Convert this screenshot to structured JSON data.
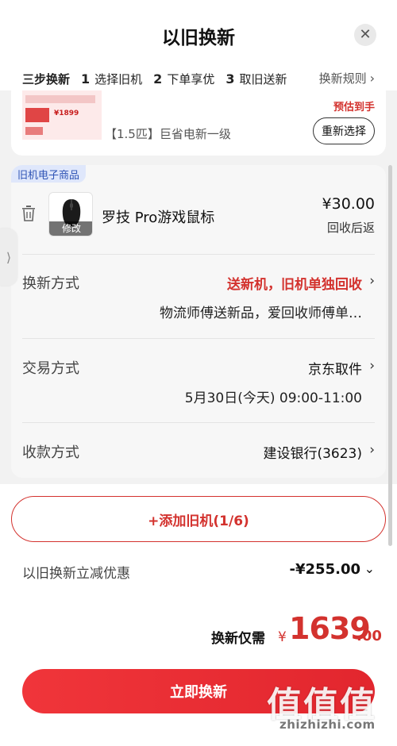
{
  "header": {
    "title": "以旧换新",
    "close_icon": "close-icon"
  },
  "steps": {
    "title": "三步换新",
    "items": [
      {
        "num": "1",
        "label": "选择旧机"
      },
      {
        "num": "2",
        "label": "下单享优"
      },
      {
        "num": "3",
        "label": "取旧送新"
      }
    ],
    "rules_label": "换新规则",
    "rules_icon": "chevron-right-icon"
  },
  "new_product": {
    "estimate_label": "预估到手",
    "name": "【1.5匹】巨省电新一级",
    "reselect_label": "重新选择",
    "thumb_price": "¥1899"
  },
  "old_item": {
    "tag": "旧机电子商品",
    "name": "罗技 Pro游戏鼠标",
    "edit_label": "修改",
    "price": "¥30.00",
    "price_note": "回收后返"
  },
  "rows": {
    "exchange": {
      "label": "换新方式",
      "value": "送新机，旧机单独回收",
      "sub": "物流师傅送新品，爱回收师傅单…"
    },
    "transaction": {
      "label": "交易方式",
      "value": "京东取件",
      "sub": "5月30日(今天) 09:00-11:00"
    },
    "payment": {
      "label": "收款方式",
      "value": "建设银行(3623)"
    }
  },
  "add_button": "+添加旧机(1/6)",
  "discount": {
    "label": "以旧换新立减优惠",
    "value": "-¥255.00"
  },
  "total": {
    "label": "换新仅需",
    "currency": "¥",
    "integer": "1639",
    "decimal": ".00"
  },
  "cta": {
    "label": "立即换新"
  },
  "watermark": {
    "chars": "值值值",
    "text": "zhizhizhi.com"
  },
  "colors": {
    "accent": "#d3322e",
    "cta": "#e2262e",
    "tag_bg": "#dfe7fb",
    "tag_text": "#2e53b5"
  }
}
